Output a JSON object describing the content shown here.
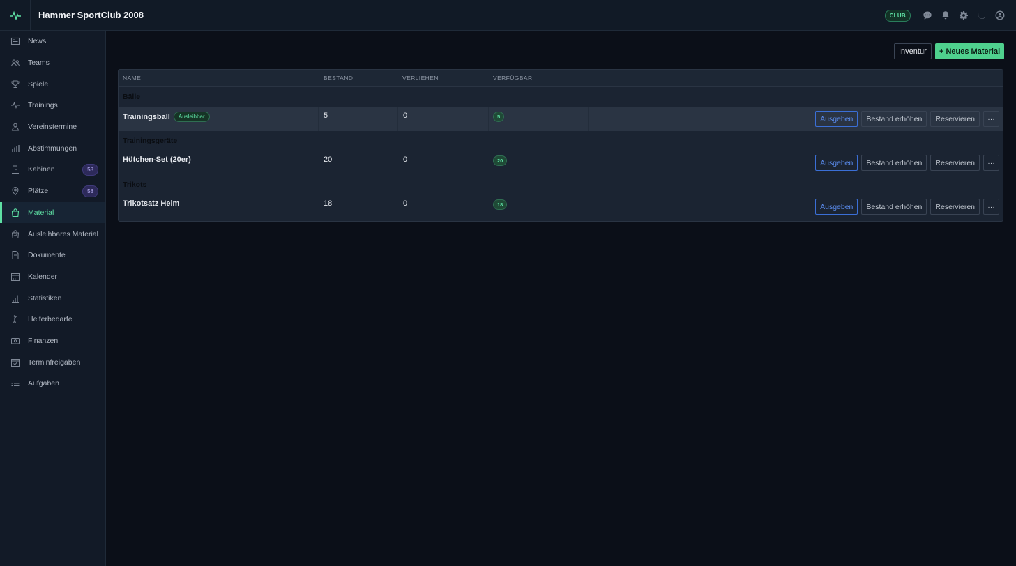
{
  "app": {
    "title": "Hammer SportClub 2008",
    "club_badge": "CLUB"
  },
  "topbar": {
    "icons": [
      "pulse-icon",
      "chat-icon",
      "bell-icon",
      "gear-icon",
      "moon-icon",
      "user-circle-icon"
    ]
  },
  "sidebar": {
    "items": [
      {
        "label": "News",
        "icon": "newspaper-icon"
      },
      {
        "label": "Teams",
        "icon": "users-icon"
      },
      {
        "label": "Spiele",
        "icon": "trophy-icon"
      },
      {
        "label": "Trainings",
        "icon": "activity-icon"
      },
      {
        "label": "Vereinstermine",
        "icon": "person-icon"
      },
      {
        "label": "Abstimmungen",
        "icon": "bar-chart-icon"
      },
      {
        "label": "Kabinen",
        "icon": "door-icon",
        "badge": "58"
      },
      {
        "label": "Plätze",
        "icon": "map-pin-icon",
        "badge": "58"
      },
      {
        "label": "Material",
        "icon": "bag-icon",
        "active": true
      },
      {
        "label": "Ausleihbares Material",
        "icon": "bag-check-icon"
      },
      {
        "label": "Dokumente",
        "icon": "document-icon"
      },
      {
        "label": "Kalender",
        "icon": "calendar-icon"
      },
      {
        "label": "Statistiken",
        "icon": "stats-icon"
      },
      {
        "label": "Helferbedarfe",
        "icon": "helper-icon"
      },
      {
        "label": "Finanzen",
        "icon": "money-icon"
      },
      {
        "label": "Terminfreigaben",
        "icon": "calendar-check-icon"
      },
      {
        "label": "Aufgaben",
        "icon": "list-icon"
      }
    ]
  },
  "toolbar": {
    "inventur_label": "Inventur",
    "new_label": "+ Neues Material"
  },
  "table": {
    "headers": {
      "name": "NAME",
      "bestand": "BESTAND",
      "verliehen": "VERLIEHEN",
      "verfuegbar": "VERFÜGBAR"
    },
    "groups": [
      {
        "title": "Bälle",
        "items": [
          {
            "name": "Trainingsball",
            "tag": "Ausleihbar",
            "bestand": "5",
            "verliehen": "0",
            "verfuegbar": "5",
            "highlighted": true
          }
        ]
      },
      {
        "title": "Trainingsgeräte",
        "items": [
          {
            "name": "Hütchen-Set (20er)",
            "bestand": "20",
            "verliehen": "0",
            "verfuegbar": "20"
          }
        ]
      },
      {
        "title": "Trikots",
        "items": [
          {
            "name": "Trikotsatz Heim",
            "bestand": "18",
            "verliehen": "0",
            "verfuegbar": "18"
          }
        ]
      }
    ],
    "actions": {
      "issue": "Ausgeben",
      "increase": "Bestand erhöhen",
      "reserve": "Reservieren",
      "more": "···"
    }
  },
  "colors": {
    "accent": "#5ee0a4",
    "primary_button": "#4fd18e",
    "link_blue": "#5b8df0",
    "badge_purple": "#2d2a5a"
  }
}
